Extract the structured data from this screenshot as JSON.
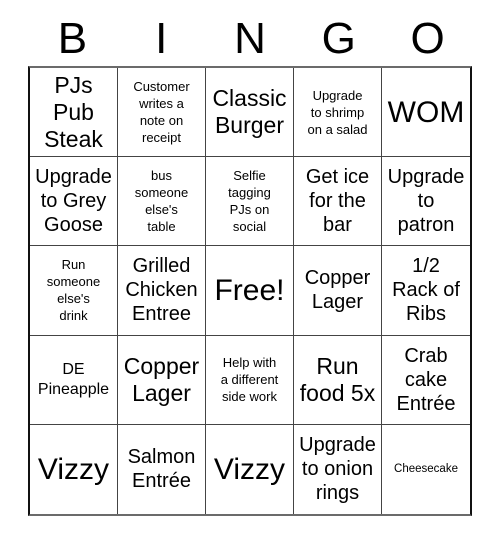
{
  "card": {
    "title": "BINGO",
    "header_letters": [
      "B",
      "I",
      "N",
      "G",
      "O"
    ],
    "grid_size": "5x5",
    "free_space_label": "Free!",
    "colors": {
      "background": "#ffffff",
      "text": "#000000",
      "cell_border": "#444444",
      "outer_border": "#111111"
    },
    "rows": [
      [
        {
          "text": "PJs\nPub\nSteak",
          "size": "fs-lg"
        },
        {
          "text": "Customer\nwrites a\nnote on\nreceipt",
          "size": "fs-xs"
        },
        {
          "text": "Classic\nBurger",
          "size": "fs-lg"
        },
        {
          "text": "Upgrade\nto shrimp\non a salad",
          "size": "fs-xs"
        },
        {
          "text": "WOM",
          "size": "fs-xl"
        }
      ],
      [
        {
          "text": "Upgrade\nto Grey\nGoose",
          "size": "fs-md"
        },
        {
          "text": "bus\nsomeone\nelse's\ntable",
          "size": "fs-xs"
        },
        {
          "text": "Selfie\ntagging\nPJs on\nsocial",
          "size": "fs-xs"
        },
        {
          "text": "Get ice\nfor the\nbar",
          "size": "fs-md"
        },
        {
          "text": "Upgrade\nto\npatron",
          "size": "fs-md"
        }
      ],
      [
        {
          "text": "Run\nsomeone\nelse's\ndrink",
          "size": "fs-xs"
        },
        {
          "text": "Grilled\nChicken\nEntree",
          "size": "fs-md"
        },
        {
          "text": "Free!",
          "size": "fs-xl"
        },
        {
          "text": "Copper\nLager",
          "size": "fs-md"
        },
        {
          "text": "1/2\nRack of\nRibs",
          "size": "fs-md"
        }
      ],
      [
        {
          "text": "DE\nPineapple",
          "size": "fs-sm"
        },
        {
          "text": "Copper\nLager",
          "size": "fs-lg"
        },
        {
          "text": "Help with\na different\nside work",
          "size": "fs-xs"
        },
        {
          "text": "Run\nfood 5x",
          "size": "fs-lg"
        },
        {
          "text": "Crab\ncake\nEntrée",
          "size": "fs-md"
        }
      ],
      [
        {
          "text": "Vizzy",
          "size": "fs-xl"
        },
        {
          "text": "Salmon\nEntrée",
          "size": "fs-md"
        },
        {
          "text": "Vizzy",
          "size": "fs-xl"
        },
        {
          "text": "Upgrade\nto onion\nrings",
          "size": "fs-md"
        },
        {
          "text": "Cheesecake",
          "size": "fs-xxs"
        }
      ]
    ]
  }
}
